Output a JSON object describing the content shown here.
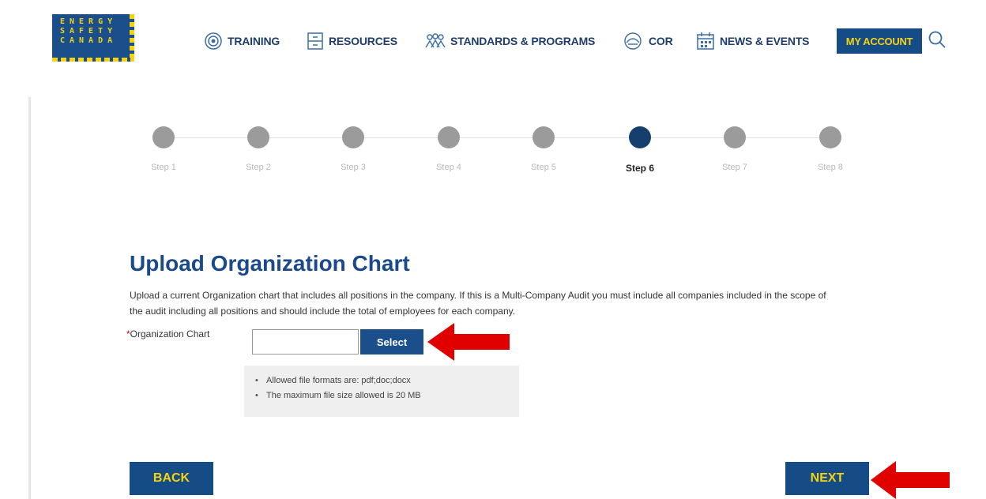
{
  "logo": {
    "lines": [
      "ENERGY",
      "SAFETY",
      "CANADA"
    ]
  },
  "nav": {
    "items": [
      {
        "label": "TRAINING",
        "icon": "training-icon"
      },
      {
        "label": "RESOURCES",
        "icon": "resources-icon"
      },
      {
        "label": "STANDARDS & PROGRAMS",
        "icon": "standards-icon"
      },
      {
        "label": "COR",
        "icon": "cor-icon"
      },
      {
        "label": "NEWS & EVENTS",
        "icon": "news-events-icon"
      }
    ],
    "account_label": "MY ACCOUNT",
    "search_icon": "search-icon"
  },
  "stepper": {
    "steps": [
      "Step 1",
      "Step 2",
      "Step 3",
      "Step 4",
      "Step 5",
      "Step 6",
      "Step 7",
      "Step 8"
    ],
    "active_index": 5
  },
  "form": {
    "title": "Upload Organization Chart",
    "description": "Upload a current Organization chart that includes all positions in the company.  If this is a Multi-Company Audit you must include all companies included in the scope of the audit including all positions and should include the total of employees for each company.",
    "field_required_mark": "*",
    "field_label": "Organization Chart",
    "file_value": "",
    "select_label": "Select",
    "hints": [
      "Allowed file formats are: pdf;doc;docx",
      "The maximum file size allowed is 20 MB"
    ]
  },
  "footer": {
    "back_label": "BACK",
    "next_label": "NEXT"
  },
  "colors": {
    "brand_blue": "#164c86",
    "brand_yellow": "#f5d312",
    "step_active": "#173f6e",
    "step_inactive": "#9b9b9b",
    "annotation_arrow": "#e00000"
  }
}
